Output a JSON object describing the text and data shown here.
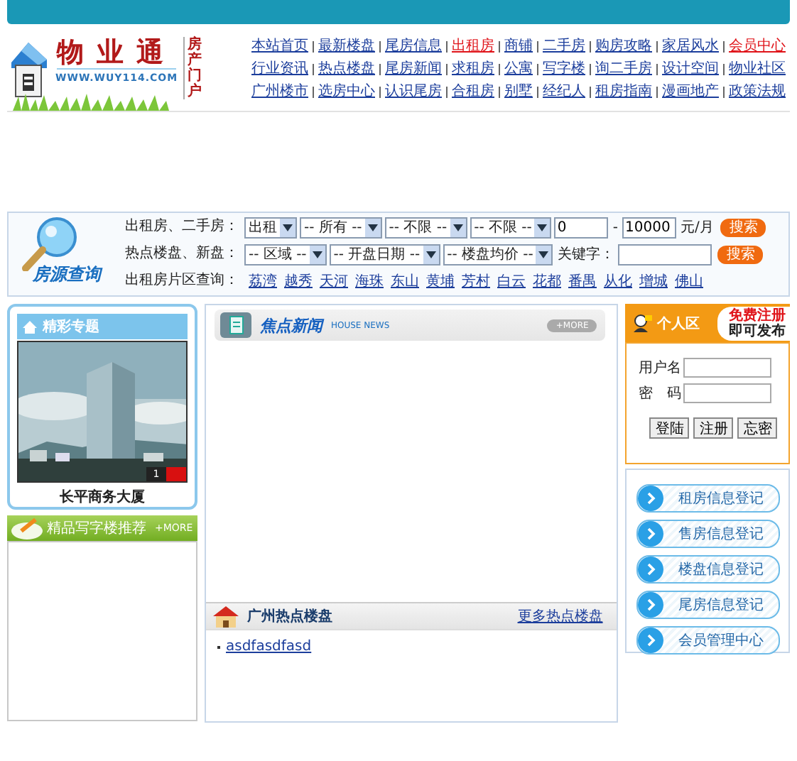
{
  "header": {
    "logo_title": "物业通",
    "site_url": "WWW.WUY114.COM",
    "tagline": "房产门户",
    "nav_rows": [
      [
        {
          "label": "本站首页",
          "highlighted": false
        },
        {
          "label": "最新楼盘",
          "highlighted": false
        },
        {
          "label": "尾房信息",
          "highlighted": false
        },
        {
          "label": "出租房",
          "highlighted": true
        },
        {
          "label": "商铺",
          "highlighted": false
        },
        {
          "label": "二手房",
          "highlighted": false
        },
        {
          "label": "购房攻略",
          "highlighted": false
        },
        {
          "label": "家居风水",
          "highlighted": false
        },
        {
          "label": "会员中心",
          "highlighted": true
        }
      ],
      [
        {
          "label": "行业资讯",
          "highlighted": false
        },
        {
          "label": "热点楼盘",
          "highlighted": false
        },
        {
          "label": "尾房新闻",
          "highlighted": false
        },
        {
          "label": "求租房",
          "highlighted": false
        },
        {
          "label": "公寓",
          "highlighted": false
        },
        {
          "label": "写字楼",
          "highlighted": false
        },
        {
          "label": "询二手房",
          "highlighted": false
        },
        {
          "label": "设计空间",
          "highlighted": false
        },
        {
          "label": "物业社区",
          "highlighted": false
        }
      ],
      [
        {
          "label": "广州楼市",
          "highlighted": false
        },
        {
          "label": "选房中心",
          "highlighted": false
        },
        {
          "label": "认识尾房",
          "highlighted": false
        },
        {
          "label": "合租房",
          "highlighted": false
        },
        {
          "label": "别墅",
          "highlighted": false
        },
        {
          "label": "经纪人",
          "highlighted": false
        },
        {
          "label": "租房指南",
          "highlighted": false
        },
        {
          "label": "漫画地产",
          "highlighted": false
        },
        {
          "label": "政策法规",
          "highlighted": false
        }
      ]
    ]
  },
  "search": {
    "title": "房源查询",
    "rows": [
      {
        "label": "出租房、二手房：",
        "controls": [
          {
            "kind": "select",
            "value": "出租"
          },
          {
            "kind": "select",
            "value": "-- 所有 --"
          },
          {
            "kind": "select",
            "value": "-- 不限 --"
          },
          {
            "kind": "select",
            "value": "-- 不限 --"
          },
          {
            "kind": "input",
            "value": "0"
          },
          {
            "kind": "text",
            "label": "-"
          },
          {
            "kind": "input",
            "value": "10000"
          },
          {
            "kind": "text",
            "label": "元/月"
          },
          {
            "kind": "button",
            "label": "搜索"
          }
        ]
      },
      {
        "label": "热点楼盘、新盘：",
        "controls": [
          {
            "kind": "select",
            "value": "-- 区域 --"
          },
          {
            "kind": "select",
            "value": "-- 开盘日期 --"
          },
          {
            "kind": "select",
            "value": "-- 楼盘均价 --"
          },
          {
            "kind": "text",
            "label": "关键字："
          },
          {
            "kind": "input"
          },
          {
            "kind": "button",
            "label": "搜索"
          }
        ]
      },
      {
        "label": "出租房片区查询：",
        "controls": [
          {
            "kind": "link",
            "label": "荔湾"
          },
          {
            "kind": "link",
            "label": "越秀"
          },
          {
            "kind": "link",
            "label": "天河"
          },
          {
            "kind": "link",
            "label": "海珠"
          },
          {
            "kind": "link",
            "label": "东山"
          },
          {
            "kind": "link",
            "label": "黄埔"
          },
          {
            "kind": "link",
            "label": "芳村"
          },
          {
            "kind": "link",
            "label": "白云"
          },
          {
            "kind": "link",
            "label": "花都"
          },
          {
            "kind": "link",
            "label": "番禺"
          },
          {
            "kind": "link",
            "label": "从化"
          },
          {
            "kind": "link",
            "label": "增城"
          },
          {
            "kind": "link",
            "label": "佛山"
          }
        ]
      }
    ]
  },
  "featured": {
    "title": "精彩专题",
    "caption": "长平商务大厦",
    "pager": [
      {
        "label": "1",
        "selected": false
      },
      {
        "selected": true
      }
    ]
  },
  "office": {
    "title": "精品写字楼推荐",
    "more": "+MORE"
  },
  "news": {
    "title": "焦点新闻",
    "subtitle": "HOUSE NEWS",
    "more": "+MORE"
  },
  "hot": {
    "title": "广州热点楼盘",
    "more": "更多热点楼盘",
    "items": [
      "asdfasdfasd"
    ]
  },
  "login": {
    "title": "个人区",
    "promo": [
      "免费注册",
      "即可发布"
    ],
    "fields": [
      {
        "label": "用户名"
      },
      {
        "label": "密　码"
      }
    ],
    "buttons": [
      "登陆",
      "注册",
      "忘密"
    ]
  },
  "quick_links": [
    "租房信息登记",
    "售房信息登记",
    "楼盘信息登记",
    "尾房信息登记",
    "会员管理中心"
  ]
}
